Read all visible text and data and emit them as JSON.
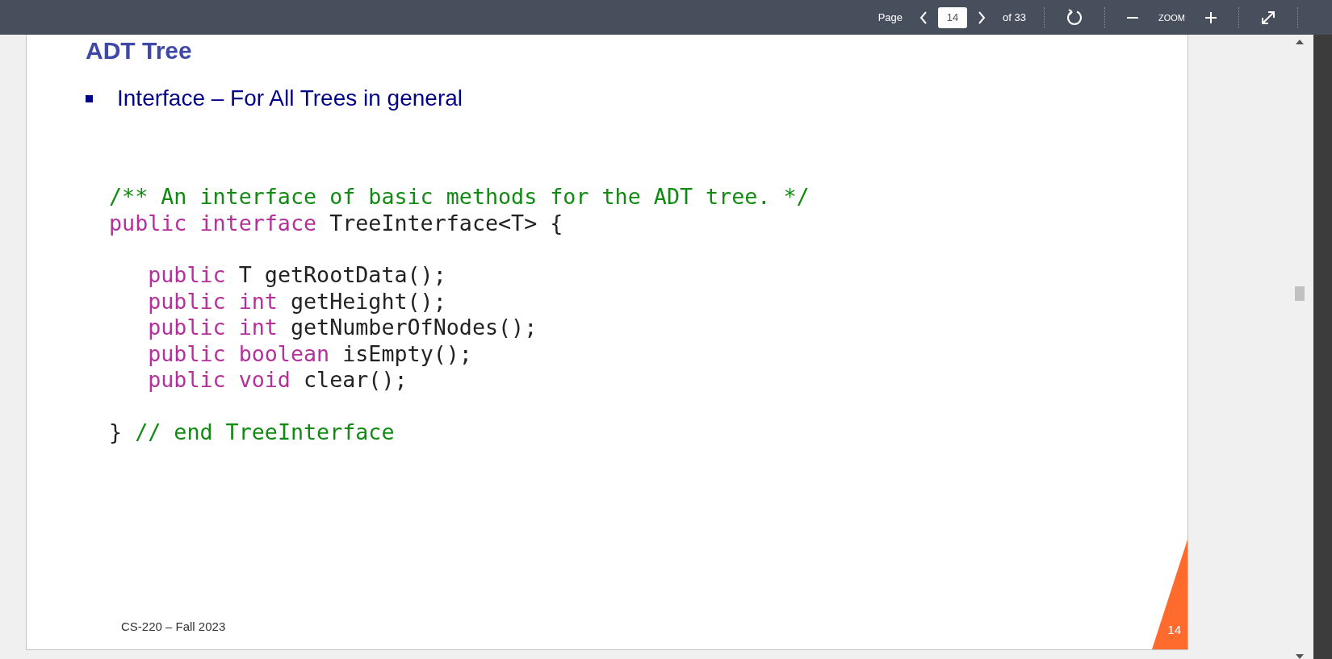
{
  "toolbar": {
    "page_label": "Page",
    "page_value": "14",
    "page_total": "of 33",
    "zoom_label": "ZOOM"
  },
  "slide": {
    "title": "ADT Tree",
    "bullets": [
      "Interface – For All Trees in general"
    ],
    "code_blocks": [
      [
        [
          {
            "kind": "comment",
            "text": "/** An interface of basic methods for the ADT tree. */"
          }
        ],
        [
          {
            "kind": "keyword",
            "text": "public interface"
          },
          {
            "kind": "plain",
            "text": " TreeInterface<T> {"
          }
        ]
      ],
      [
        [
          {
            "kind": "keyword",
            "text": "   public"
          },
          {
            "kind": "plain",
            "text": " T getRootData();"
          }
        ],
        [
          {
            "kind": "keyword",
            "text": "   public int"
          },
          {
            "kind": "plain",
            "text": " getHeight();"
          }
        ],
        [
          {
            "kind": "keyword",
            "text": "   public int"
          },
          {
            "kind": "plain",
            "text": " getNumberOfNodes();"
          }
        ],
        [
          {
            "kind": "keyword",
            "text": "   public boolean"
          },
          {
            "kind": "plain",
            "text": " isEmpty();"
          }
        ],
        [
          {
            "kind": "keyword",
            "text": "   public void"
          },
          {
            "kind": "plain",
            "text": " clear();"
          }
        ]
      ],
      [
        [
          {
            "kind": "plain",
            "text": "} "
          },
          {
            "kind": "comment",
            "text": "// end TreeInterface"
          }
        ]
      ]
    ],
    "footer": "CS-220 – Fall 2023",
    "slide_number": "14"
  }
}
